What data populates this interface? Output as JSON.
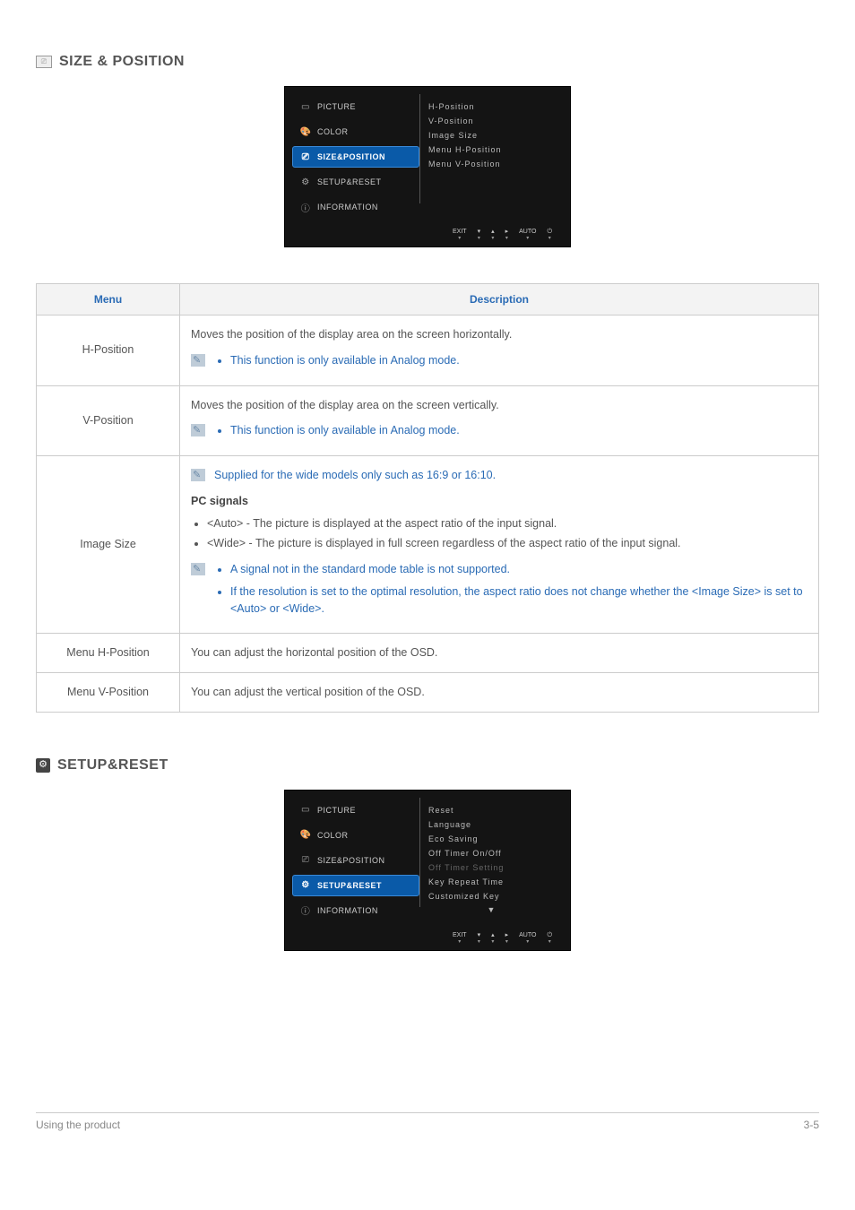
{
  "sections": {
    "size_position": {
      "title": "SIZE & POSITION",
      "osd": {
        "left": [
          {
            "label": "PICTURE",
            "icon": "▭",
            "selected": false
          },
          {
            "label": "COLOR",
            "icon": "🎨",
            "selected": false
          },
          {
            "label": "SIZE&POSITION",
            "icon": "⎚",
            "selected": true
          },
          {
            "label": "SETUP&RESET",
            "icon": "⚙",
            "selected": false
          },
          {
            "label": "INFORMATION",
            "icon": "ⓘ",
            "selected": false
          }
        ],
        "right": [
          {
            "label": "H-Position"
          },
          {
            "label": "V-Position"
          },
          {
            "label": "Image Size"
          },
          {
            "label": "Menu H-Position"
          },
          {
            "label": "Menu V-Position"
          }
        ],
        "bottom": [
          "EXIT",
          "▾",
          "▴",
          "▸",
          "AUTO",
          "⏻"
        ]
      }
    },
    "setup_reset": {
      "title": "SETUP&RESET",
      "osd": {
        "left": [
          {
            "label": "PICTURE",
            "icon": "▭",
            "selected": false
          },
          {
            "label": "COLOR",
            "icon": "🎨",
            "selected": false
          },
          {
            "label": "SIZE&POSITION",
            "icon": "⎚",
            "selected": false
          },
          {
            "label": "SETUP&RESET",
            "icon": "⚙",
            "selected": true
          },
          {
            "label": "INFORMATION",
            "icon": "ⓘ",
            "selected": false
          }
        ],
        "right": [
          {
            "label": "Reset"
          },
          {
            "label": "Language"
          },
          {
            "label": "Eco Saving"
          },
          {
            "label": "Off Timer On/Off"
          },
          {
            "label": "Off Timer Setting",
            "dim": true
          },
          {
            "label": "Key Repeat Time"
          },
          {
            "label": "Customized Key"
          }
        ],
        "scroll_arrow": "▼",
        "bottom": [
          "EXIT",
          "▾",
          "▴",
          "▸",
          "AUTO",
          "⏻"
        ]
      }
    }
  },
  "table": {
    "headers": {
      "menu": "Menu",
      "description": "Description"
    },
    "rows": {
      "h_position": {
        "menu": "H-Position",
        "desc": "Moves the position of the display area on the screen horizontally.",
        "note": "This function is only available in Analog mode."
      },
      "v_position": {
        "menu": "V-Position",
        "desc": "Moves the position of the display area on the screen vertically.",
        "note": "This function is only available in Analog mode."
      },
      "image_size": {
        "menu": "Image Size",
        "top_note": "Supplied for the wide models only such as 16:9 or 16:10.",
        "pc_signals_label": "PC signals",
        "pc_signals": [
          "<Auto> - The picture is displayed at the aspect ratio of the input signal.",
          "<Wide> - The picture is displayed in full screen regardless of the aspect ratio of the input signal."
        ],
        "bottom_notes": [
          "A signal not in the standard mode table is not supported.",
          "If the resolution is set to the optimal resolution, the aspect ratio does not change whether the <Image Size> is set to <Auto> or <Wide>."
        ]
      },
      "menu_h": {
        "menu": "Menu H-Position",
        "desc": "You can adjust the horizontal position of the OSD."
      },
      "menu_v": {
        "menu": "Menu V-Position",
        "desc": "You can adjust the vertical position of the OSD."
      }
    }
  },
  "footer": {
    "left": "Using the product",
    "right": "3-5"
  }
}
